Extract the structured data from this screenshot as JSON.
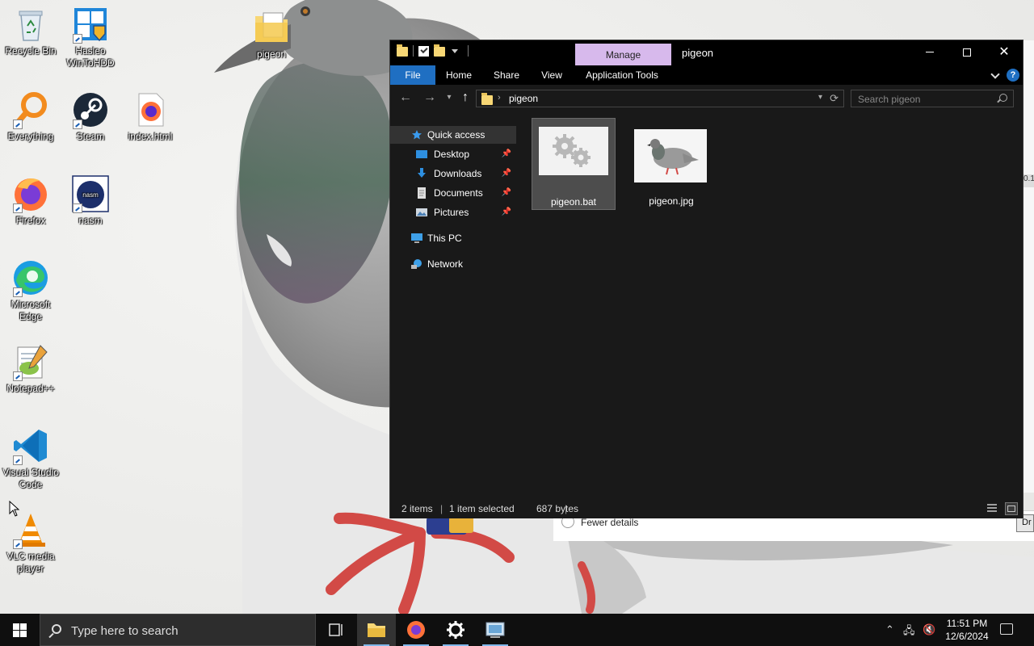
{
  "desktop": {
    "icons": [
      {
        "label": "Recycle Bin",
        "icon": "recycle-bin-icon"
      },
      {
        "label": "Hasleo WinToHDD",
        "icon": "hasleo-icon"
      },
      {
        "label": "pigeon",
        "icon": "folder-icon"
      },
      {
        "label": "Everything",
        "icon": "everything-icon"
      },
      {
        "label": "Steam",
        "icon": "steam-icon"
      },
      {
        "label": "index.html",
        "icon": "firefox-html-icon"
      },
      {
        "label": "Firefox",
        "icon": "firefox-icon"
      },
      {
        "label": "nasm",
        "icon": "nasm-icon"
      },
      {
        "label": "Microsoft Edge",
        "icon": "edge-icon"
      },
      {
        "label": "Notepad++",
        "icon": "notepadpp-icon"
      },
      {
        "label": "Visual Studio Code",
        "icon": "vscode-icon"
      },
      {
        "label": "VLC media player",
        "icon": "vlc-icon"
      }
    ]
  },
  "background_dialog": {
    "fewer_details": "Fewer details",
    "button_stub": "Dr",
    "edge_mark": "0.1"
  },
  "explorer": {
    "title": "pigeon",
    "manage_tab": "Manage",
    "ribbon_tabs": {
      "file": "File",
      "home": "Home",
      "share": "Share",
      "view": "View",
      "app_tools": "Application Tools"
    },
    "help": "?",
    "address": {
      "crumb": "pigeon"
    },
    "search_placeholder": "Search pigeon",
    "nav_pane": {
      "quick_access": "Quick access",
      "desktop": "Desktop",
      "downloads": "Downloads",
      "documents": "Documents",
      "pictures": "Pictures",
      "this_pc": "This PC",
      "network": "Network"
    },
    "files": [
      {
        "name": "pigeon.bat",
        "selected": true
      },
      {
        "name": "pigeon.jpg",
        "selected": false
      }
    ],
    "status": {
      "items": "2 items",
      "selected": "1 item selected",
      "size": "687 bytes"
    }
  },
  "taskbar": {
    "search_placeholder": "Type here to search",
    "time": "11:51 PM",
    "date": "12/6/2024"
  },
  "colors": {
    "ribbon_file": "#1f6fc2",
    "manage_tab": "#d7b9ec",
    "window_bg": "#191919",
    "taskbar": "#0f0f0f"
  }
}
